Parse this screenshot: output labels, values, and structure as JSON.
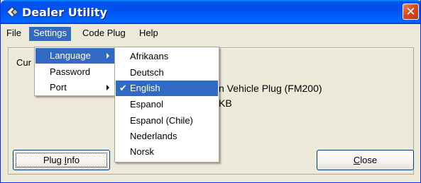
{
  "window": {
    "title": "Dealer Utility",
    "close_glyph": "✕"
  },
  "menubar": {
    "items": [
      {
        "label": "File"
      },
      {
        "label": "Settings"
      },
      {
        "label": "Code Plug"
      },
      {
        "label": "Help"
      }
    ]
  },
  "main": {
    "current_label_partial": "Cur",
    "info_line_1_partial": "n Vehicle Plug (FM200)",
    "info_line_2_partial": "KB",
    "plug_info_button": {
      "before": "Plug ",
      "hotkey": "I",
      "after": "nfo"
    },
    "close_button": {
      "hotkey": "C",
      "after": "lose"
    }
  },
  "settings_menu": {
    "items": [
      {
        "label": "Language",
        "has_submenu": true,
        "highlighted": true
      },
      {
        "label": "Password",
        "has_submenu": false,
        "highlighted": false
      },
      {
        "label": "Port",
        "has_submenu": true,
        "highlighted": false
      }
    ]
  },
  "language_menu": {
    "check_glyph": "✔",
    "items": [
      {
        "label": "Afrikaans",
        "checked": false
      },
      {
        "label": "Deutsch",
        "checked": false
      },
      {
        "label": "English",
        "checked": true
      },
      {
        "label": "Espanol",
        "checked": false
      },
      {
        "label": "Espanol (Chile)",
        "checked": false
      },
      {
        "label": "Nederlands",
        "checked": false
      },
      {
        "label": "Norsk",
        "checked": false
      }
    ]
  },
  "colors": {
    "titlebar": "#0054E3",
    "highlight": "#316AC5",
    "window_bg": "#ECE9D8"
  }
}
